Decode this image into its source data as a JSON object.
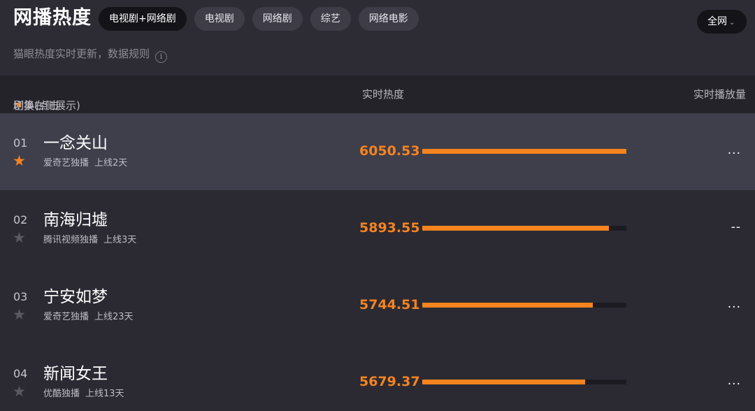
{
  "header": {
    "title": "网播热度",
    "tabs": [
      {
        "label": "电视剧+网络剧",
        "active": true
      },
      {
        "label": "电视剧",
        "active": false
      },
      {
        "label": "网络剧",
        "active": false
      },
      {
        "label": "综艺",
        "active": false
      },
      {
        "label": "网络电影",
        "active": false
      }
    ],
    "scope_select": {
      "value": "全网",
      "chevron": "⌄"
    },
    "subtitle": "猫眼热度实时更新，数据规则",
    "info_icon": "i"
  },
  "columns": {
    "name_prefix": "剧集(点击",
    "name_star": "★",
    "name_suffix": "切换右侧展示)",
    "heat": "实时热度",
    "plays": "实时播放量"
  },
  "colors": {
    "accent": "#f5841f",
    "star_off": "#5a5962",
    "highlight_row": "#3f3e4b"
  },
  "rows": [
    {
      "rank": "01",
      "starred": true,
      "title": "一念关山",
      "platform": "爱奇艺独播",
      "online": "上线2天",
      "heat": "6050.53",
      "heat_value": 6050.53,
      "plays": "..."
    },
    {
      "rank": "02",
      "starred": false,
      "title": "南海归墟",
      "platform": "腾讯视频独播",
      "online": "上线3天",
      "heat": "5893.55",
      "heat_value": 5893.55,
      "plays": "--"
    },
    {
      "rank": "03",
      "starred": false,
      "title": "宁安如梦",
      "platform": "爱奇艺独播",
      "online": "上线23天",
      "heat": "5744.51",
      "heat_value": 5744.51,
      "plays": "..."
    },
    {
      "rank": "04",
      "starred": false,
      "title": "新闻女王",
      "platform": "优酷独播",
      "online": "上线13天",
      "heat": "5679.37",
      "heat_value": 5679.37,
      "plays": "..."
    }
  ]
}
